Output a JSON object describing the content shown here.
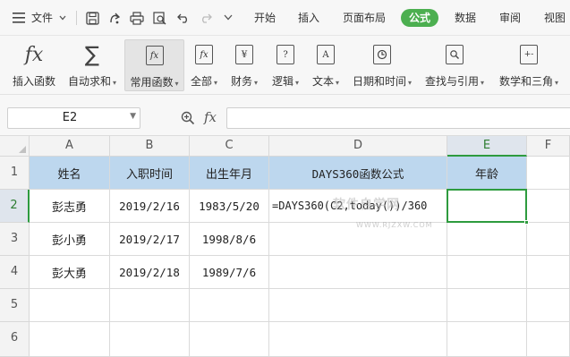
{
  "menubar": {
    "file_label": "文件",
    "tabs": [
      {
        "label": "开始"
      },
      {
        "label": "插入"
      },
      {
        "label": "页面布局"
      },
      {
        "label": "公式"
      },
      {
        "label": "数据"
      },
      {
        "label": "审阅"
      },
      {
        "label": "视图"
      }
    ],
    "active_tab": "公式",
    "accent_color": "#4caf50"
  },
  "ribbon": {
    "buttons": [
      {
        "label": "插入函数",
        "icon": "fx-icon"
      },
      {
        "label": "自动求和",
        "icon": "sigma-icon"
      },
      {
        "label": "常用函数",
        "icon": "common-function-icon"
      },
      {
        "label": "全部",
        "icon": "all-functions-icon"
      },
      {
        "label": "财务",
        "icon": "finance-icon"
      },
      {
        "label": "逻辑",
        "icon": "logic-icon"
      },
      {
        "label": "文本",
        "icon": "text-function-icon"
      },
      {
        "label": "日期和时间",
        "icon": "datetime-icon"
      },
      {
        "label": "查找与引用",
        "icon": "lookup-icon"
      },
      {
        "label": "数学和三角",
        "icon": "math-icon"
      }
    ]
  },
  "formula_bar": {
    "name_box": "E2",
    "fx_label": "fx",
    "formula": ""
  },
  "grid": {
    "columns": [
      "A",
      "B",
      "C",
      "D",
      "E",
      "F"
    ],
    "rows": [
      "1",
      "2",
      "3",
      "4",
      "5",
      "6"
    ],
    "selected_cell": "E2",
    "header_fill": "#bdd7ee",
    "cells": {
      "A1": "姓名",
      "B1": "入职时间",
      "C1": "出生年月",
      "D1": "DAYS360函数公式",
      "E1": "年龄",
      "A2": "彭志勇",
      "B2": "2019/2/16",
      "C2": "1983/5/20",
      "D2": "=DAYS360(C2,today())/360",
      "A3": "彭小勇",
      "B3": "2019/2/17",
      "C3": "1998/8/6",
      "A4": "彭大勇",
      "B4": "2019/2/18",
      "C4": "1989/7/6"
    }
  },
  "watermark": {
    "main": "软件自学网",
    "sub": "WWW.RJZXW.COM"
  }
}
